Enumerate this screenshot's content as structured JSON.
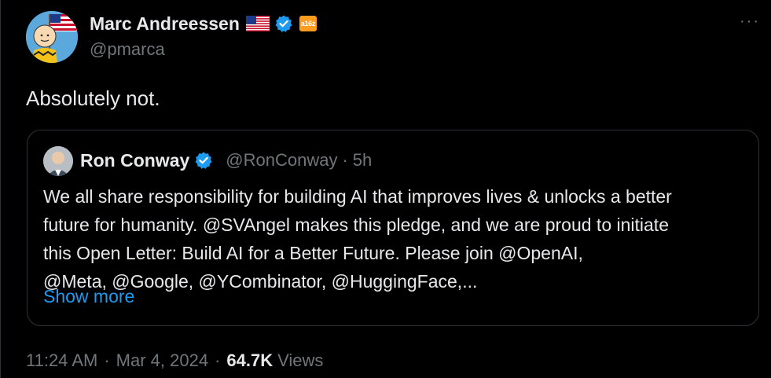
{
  "tweet": {
    "author_name": "Marc Andreessen",
    "handle": "@pmarca",
    "affiliate_badge": "a16z",
    "text": "Absolutely not.",
    "more_icon": "···",
    "timestamp_time": "11:24 AM",
    "timestamp_date": "Mar 4, 2024",
    "separator": "·",
    "views_count": "64.7K",
    "views_label": "Views"
  },
  "quote": {
    "author_name": "Ron Conway",
    "handle": "@RonConway",
    "separator": "·",
    "time": "5h",
    "lines": [
      "We all share responsibility for building AI that improves lives & unlocks a better",
      "future for humanity. @SVAngel makes this pledge, and we are proud to initiate",
      "this Open Letter: Build AI for a Better Future. Please join @OpenAI,",
      "@Meta, @Google, @YCombinator, @HuggingFace,..."
    ],
    "show_more": "Show more"
  },
  "icons": {
    "avatar": "avatar-charlie-brown",
    "flag": "us-flag-icon",
    "verified": "verified-badge-icon",
    "affiliate": "a16z-badge-icon",
    "more": "more-options-icon"
  },
  "colors": {
    "background": "#000000",
    "text_primary": "#e7e9ea",
    "text_secondary": "#71767b",
    "link": "#1d9bf0",
    "verified": "#1d9bf0",
    "border": "#2f3336",
    "a16z_badge": "#ff9b1e"
  }
}
